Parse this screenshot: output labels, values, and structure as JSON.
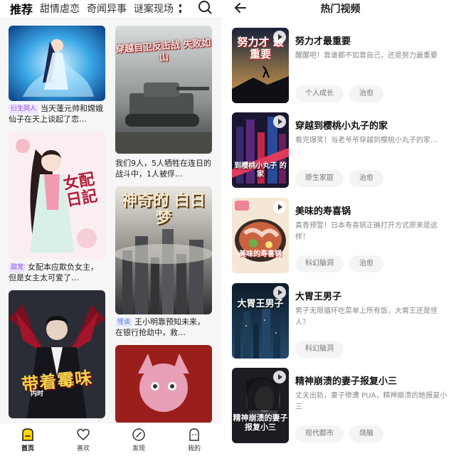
{
  "left": {
    "tabs": [
      {
        "label": "推荐",
        "active": true
      },
      {
        "label": "甜情虐恋"
      },
      {
        "label": "奇闻异事"
      },
      {
        "label": "谜案现场"
      }
    ],
    "icons": {
      "search": "search-icon",
      "more": "more-vertical-icon"
    },
    "cards": [
      {
        "tag": "衍生同人",
        "tag_color": "#8a4fe0",
        "title": "当天蓬元帅和嫦娥仙子在天上谈起了恋…"
      },
      {
        "cover_text": "穿越自卫反击战 失败如山",
        "title": "我们9人，5人牺牲在连日的战斗中，1人被俘…"
      },
      {
        "cover_text": "女配日記",
        "tag": "甜宠",
        "tag_color": "#8a4fe0",
        "title": "女配本应欺负女主，但是女主太可爱了…"
      },
      {
        "cover_text": "神奇的 白日梦",
        "tag": "怪谈",
        "tag_color": "#4f6fe0",
        "title": "王小明靠预知未来，在银行抢劫中，救…"
      },
      {
        "cover_text": "带着霉味",
        "cover_subtext": "内时"
      },
      {}
    ],
    "nav": [
      {
        "label": "首页",
        "icon": "home-icon",
        "active": true
      },
      {
        "label": "喜欢",
        "icon": "heart-icon"
      },
      {
        "label": "发现",
        "icon": "compass-icon"
      },
      {
        "label": "我的",
        "icon": "profile-icon"
      }
    ]
  },
  "right": {
    "title": "热门视频",
    "back_icon": "back-arrow-icon",
    "videos": [
      {
        "thumb_text": "努力才 最重要",
        "title": "努力才最重要",
        "desc": "醒醒吧！靠谁都不如靠自己，还是努力最重要",
        "tags": [
          "个人成长",
          "治愈"
        ]
      },
      {
        "thumb_text": "到樱桃小丸子 的家",
        "title": "穿越到樱桃小丸子的家",
        "desc": "看完爆笑！当老爷爷穿越到樱桃小丸子的家…",
        "tags": [
          "原生家庭",
          "治愈"
        ]
      },
      {
        "thumb_text": "美味的寿喜锅",
        "title": "美味的寿喜锅",
        "desc": "真香预警！日本寿喜锅正确打开方式原来是这样！",
        "tags": [
          "科幻脑洞",
          "治愈"
        ]
      },
      {
        "thumb_text": "大胃王男子",
        "title": "大胃王男子",
        "desc": "男子无限循环吃菜单上所有饭，大胃王还是怪人？",
        "tags": [
          "科幻脑洞"
        ]
      },
      {
        "thumb_text": "精神崩溃的妻子 报复小三",
        "title": "精神崩溃的妻子报复小三",
        "desc": "丈夫出轨，妻子惨遭 PUA，精神崩溃的她报复小三",
        "tags": [
          "现代都市",
          "烧脑"
        ]
      }
    ]
  },
  "colors": {
    "accent": "#ffd600",
    "tag_purple": "#8a4fe0",
    "tag_blue": "#4f6fe0"
  }
}
